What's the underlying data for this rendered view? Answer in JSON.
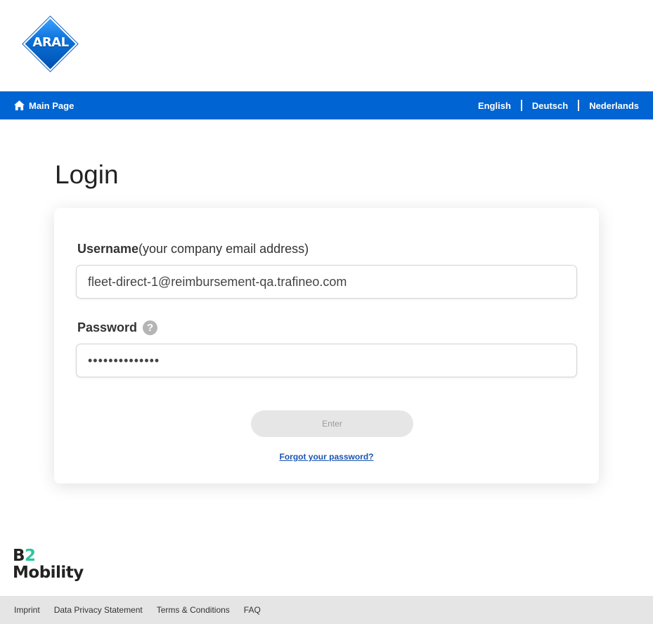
{
  "brand": {
    "logo_text": "ARAL",
    "primary_color": "#0064d2"
  },
  "nav": {
    "home_label": "Main Page",
    "languages": [
      "English",
      "Deutsch",
      "Nederlands"
    ]
  },
  "login": {
    "title": "Login",
    "username_label": "Username",
    "username_hint": "(your company email address)",
    "username_value": "fleet-direct-1@reimbursement-qa.trafineo.com",
    "password_label": "Password",
    "password_help": "?",
    "password_value": "••••••••••••••",
    "enter_label": "Enter",
    "forgot_label": "Forgot your password?"
  },
  "partner_logo": {
    "line1_a": "B",
    "line1_b": "2",
    "line2": "Mobility"
  },
  "footer": {
    "links": [
      "Imprint",
      "Data Privacy Statement",
      "Terms & Conditions",
      "FAQ"
    ]
  }
}
